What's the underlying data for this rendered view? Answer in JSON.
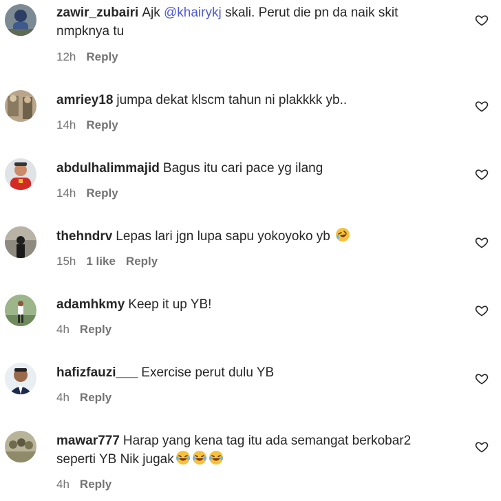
{
  "comments": [
    {
      "username": "zawir_zubairi",
      "text_before": "Ajk ",
      "mention": "@khairykj",
      "text_after": " skali. Perut die pn da naik skit nmpknya tu",
      "time": "12h",
      "reply_label": "Reply"
    },
    {
      "username": "amriey18",
      "text": "jumpa dekat klscm tahun ni plakkkk yb..",
      "time": "14h",
      "reply_label": "Reply"
    },
    {
      "username": "abdulhalimmajid",
      "text": "Bagus itu cari pace yg ilang",
      "time": "14h",
      "reply_label": "Reply"
    },
    {
      "username": "thehndrv",
      "text": "Lepas lari jgn lupa sapu yokoyoko yb",
      "emoji": "rofl-emoji",
      "time": "15h",
      "likes": "1 like",
      "reply_label": "Reply"
    },
    {
      "username": "adamhkmy",
      "text": "Keep it up YB!",
      "time": "4h",
      "reply_label": "Reply"
    },
    {
      "username": "hafizfauzi___",
      "text": "Exercise perut dulu YB",
      "time": "4h",
      "reply_label": "Reply"
    },
    {
      "username": "mawar777",
      "text": "Harap yang kena tag itu ada semangat berkobar2 seperti YB Nik jugak",
      "emoji": "tears-of-joy-emoji x3",
      "time": "4h",
      "reply_label": "Reply"
    }
  ],
  "icons": {
    "like": "heart-outline-icon"
  },
  "colors": {
    "text": "#262626",
    "meta": "#737373",
    "mention": "#4e5ad9"
  }
}
